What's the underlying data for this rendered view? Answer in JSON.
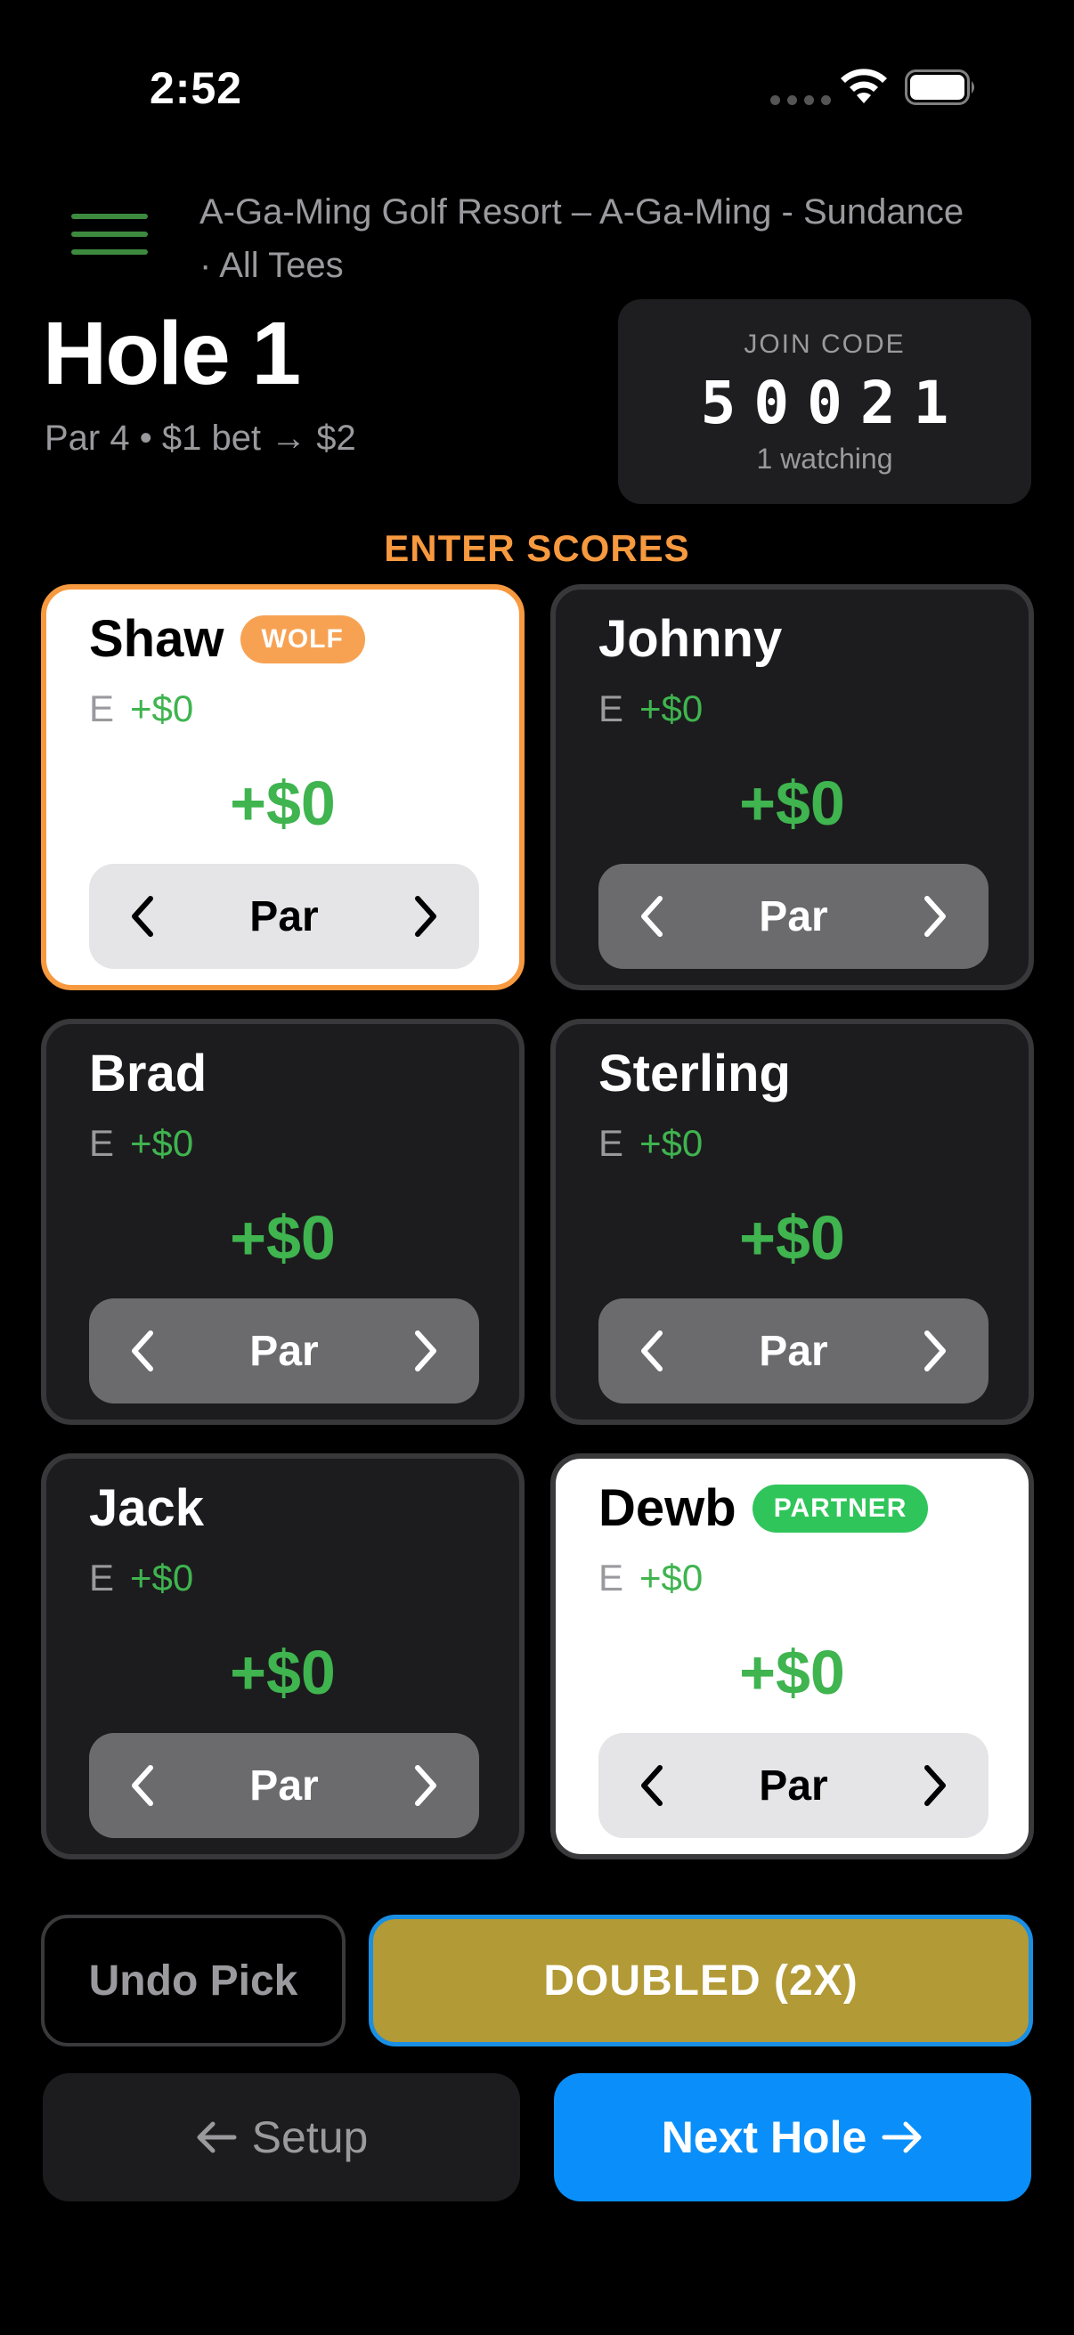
{
  "status_bar": {
    "time": "2:52"
  },
  "header": {
    "course": "A-Ga-Ming Golf Resort – A-Ga-Ming - Sundance · All Tees",
    "hole_title": "Hole 1",
    "hole_subtitle": "Par 4 • $1 bet → $2"
  },
  "join": {
    "label": "JOIN CODE",
    "code": "50021",
    "watching": "1 watching"
  },
  "section_label": "ENTER SCORES",
  "players": [
    {
      "name": "Shaw",
      "badge": "WOLF",
      "relative": "E",
      "money": "+$0",
      "amount": "+$0",
      "score": "Par"
    },
    {
      "name": "Johnny",
      "badge": "",
      "relative": "E",
      "money": "+$0",
      "amount": "+$0",
      "score": "Par"
    },
    {
      "name": "Brad",
      "badge": "",
      "relative": "E",
      "money": "+$0",
      "amount": "+$0",
      "score": "Par"
    },
    {
      "name": "Sterling",
      "badge": "",
      "relative": "E",
      "money": "+$0",
      "amount": "+$0",
      "score": "Par"
    },
    {
      "name": "Jack",
      "badge": "",
      "relative": "E",
      "money": "+$0",
      "amount": "+$0",
      "score": "Par"
    },
    {
      "name": "Dewb",
      "badge": "PARTNER",
      "relative": "E",
      "money": "+$0",
      "amount": "+$0",
      "score": "Par"
    }
  ],
  "actions": {
    "undo": "Undo Pick",
    "doubled": "DOUBLED (2X)",
    "setup": "Setup",
    "next": "Next Hole"
  },
  "colors": {
    "wolf_accent": "#f7993f",
    "partner_badge": "#2fc55a",
    "money_green": "#3fb44f",
    "doubled_bg": "#b29a36",
    "next_bg": "#0a8ffa",
    "menu_green": "#3d8a3f"
  },
  "icons": [
    "menu-icon",
    "wifi-icon",
    "battery-icon",
    "chevron-left-icon",
    "chevron-right-icon",
    "arrow-left-icon",
    "arrow-right-icon"
  ]
}
